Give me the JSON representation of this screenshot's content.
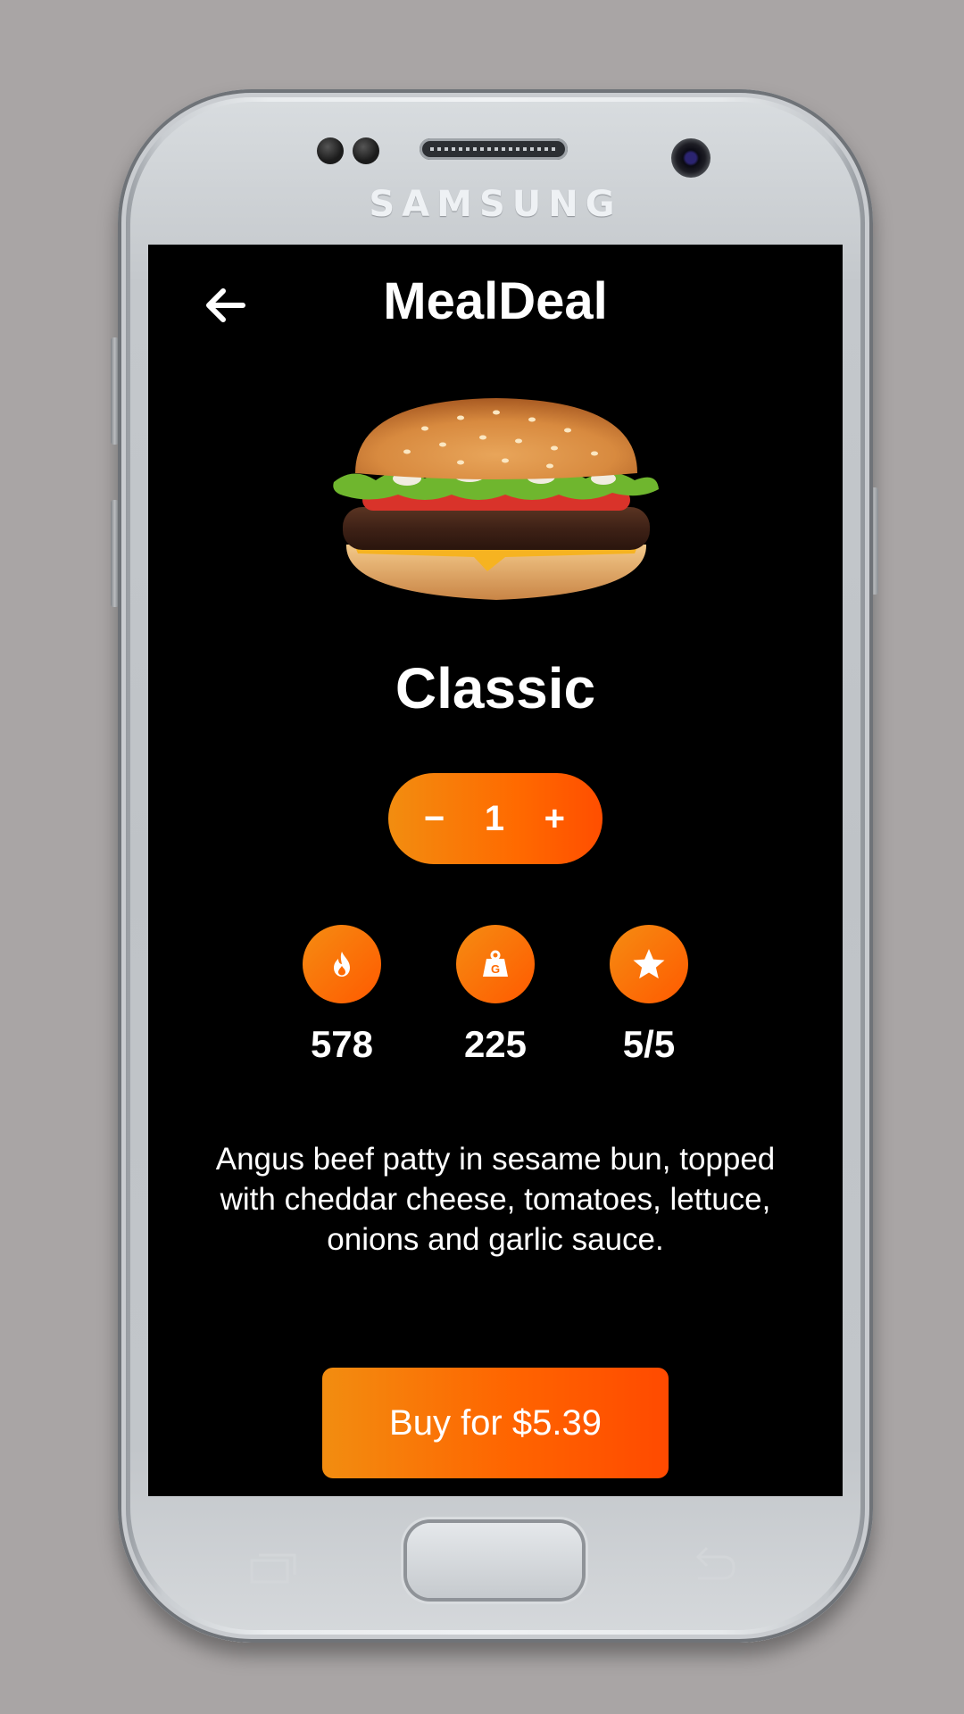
{
  "device": {
    "brand": "SAMSUNG"
  },
  "header": {
    "back_icon": "arrow-left-icon",
    "title": "MealDeal"
  },
  "product": {
    "image": "burger-image",
    "name": "Classic",
    "quantity": {
      "decrement_label": "−",
      "value": "1",
      "increment_label": "+"
    },
    "stats": [
      {
        "icon": "flame-icon",
        "value": "578"
      },
      {
        "icon": "weight-icon",
        "value": "225"
      },
      {
        "icon": "star-icon",
        "value": "5/5"
      }
    ],
    "description": "Angus beef patty in sesame bun, topped with cheddar cheese, tomatoes, lettuce, onions and garlic sauce."
  },
  "actions": {
    "buy_label": "Buy for $5.39"
  },
  "colors": {
    "accent_start": "#f28d10",
    "accent_end": "#ff4e00",
    "screen_background": "#000000",
    "page_background": "#a9a5a5"
  }
}
